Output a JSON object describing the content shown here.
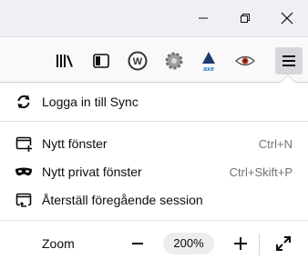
{
  "window_controls": {
    "minimize_icon": "minimize-icon",
    "restore_icon": "restore-icon",
    "close_icon": "close-icon"
  },
  "toolbar": {
    "icons": [
      "library-icon",
      "sidebar-icon",
      "w-extension-icon",
      "gear-extension-icon",
      "axe-extension-icon",
      "eye-extension-icon",
      "hamburger-menu-icon"
    ],
    "axe_label": "axe"
  },
  "menu": {
    "sync_label": "Logga in till Sync",
    "items": [
      {
        "label": "Nytt fönster",
        "shortcut": "Ctrl+N"
      },
      {
        "label": "Nytt privat fönster",
        "shortcut": "Ctrl+Skift+P"
      },
      {
        "label": "Återställ föregående session",
        "shortcut": ""
      }
    ],
    "zoom": {
      "label": "Zoom",
      "minus": "−",
      "plus": "+",
      "value": "200%"
    }
  },
  "colors": {
    "titlebar": "#f0f0f4",
    "toolbar": "#f9f9fa",
    "panel": "#ffffff",
    "shortcut_text": "#737373",
    "axe_blue": "#1d6fcf"
  }
}
